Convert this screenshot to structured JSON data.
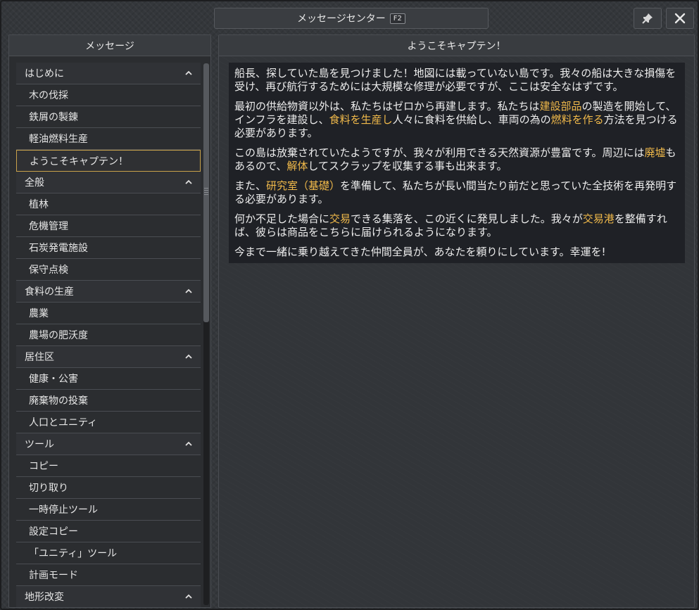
{
  "window": {
    "title": "メッセージセンター",
    "hotkey": "F2"
  },
  "left_panel": {
    "header": "メッセージ"
  },
  "sections": [
    {
      "label": "はじめに",
      "items": [
        "木の伐採",
        "鉄屑の製錬",
        "軽油燃料生産",
        "ようこそキャプテン！"
      ]
    },
    {
      "label": "全般",
      "items": [
        "植林",
        "危機管理",
        "石炭発電施設",
        "保守点検"
      ]
    },
    {
      "label": "食料の生産",
      "items": [
        "農業",
        "農場の肥沃度"
      ]
    },
    {
      "label": "居住区",
      "items": [
        "健康・公害",
        "廃棄物の投棄",
        "人口とユニティ"
      ]
    },
    {
      "label": "ツール",
      "items": [
        "コピー",
        "切り取り",
        "一時停止ツール",
        "設定コピー",
        "「ユニティ」ツール",
        "計画モード"
      ]
    },
    {
      "label": "地形改変",
      "items": []
    }
  ],
  "selected_item": "ようこそキャプテン！",
  "message": {
    "title": "ようこそキャプテン！",
    "p1": "船長、探していた島を見つけました！地図には載っていない島です。我々の船は大きな損傷を受け、再び航行するためには大規模な修理が必要ですが、ここは安全なはずです。",
    "p2": {
      "t1": "最初の供給物資以外は、私たちはゼロから再建します。私たちは",
      "h1": "建設部品",
      "t2": "の製造を開始して、インフラを建設し、",
      "h2": "食料を生産し",
      "t3": "人々に食料を供給し、車両の為の",
      "h3": "燃料を作る",
      "t4": "方法を見つける必要があります。"
    },
    "p3": {
      "t1": "この島は放棄されていたようですが、我々が利用できる天然資源が豊富です。周辺には",
      "h1": "廃墟",
      "t2": "もあるので、",
      "h2": "解体",
      "t3": "してスクラップを収集する事も出来ます。"
    },
    "p4": {
      "t1": "また、",
      "h1": "研究室（基礎）",
      "t2": "を準備して、私たちが長い間当たり前だと思っていた全技術を再発明する必要があります。"
    },
    "p5": {
      "t1": "何か不足した場合に",
      "h1": "交易",
      "t2": "できる集落を、この近くに発見しました。我々が",
      "h2": "交易港",
      "t3": "を整備すれば、彼らは商品をこちらに届けられるようになります。"
    },
    "p6": "今まで一緒に乗り越えてきた仲間全員が、あなたを頼りにしています。幸運を!"
  },
  "colors": {
    "highlight": "#f0b94a",
    "selection_border": "#c9a24a"
  },
  "icons": {
    "pin": "pin-icon",
    "close": "close-icon",
    "collapse": "chevron-up-icon"
  }
}
